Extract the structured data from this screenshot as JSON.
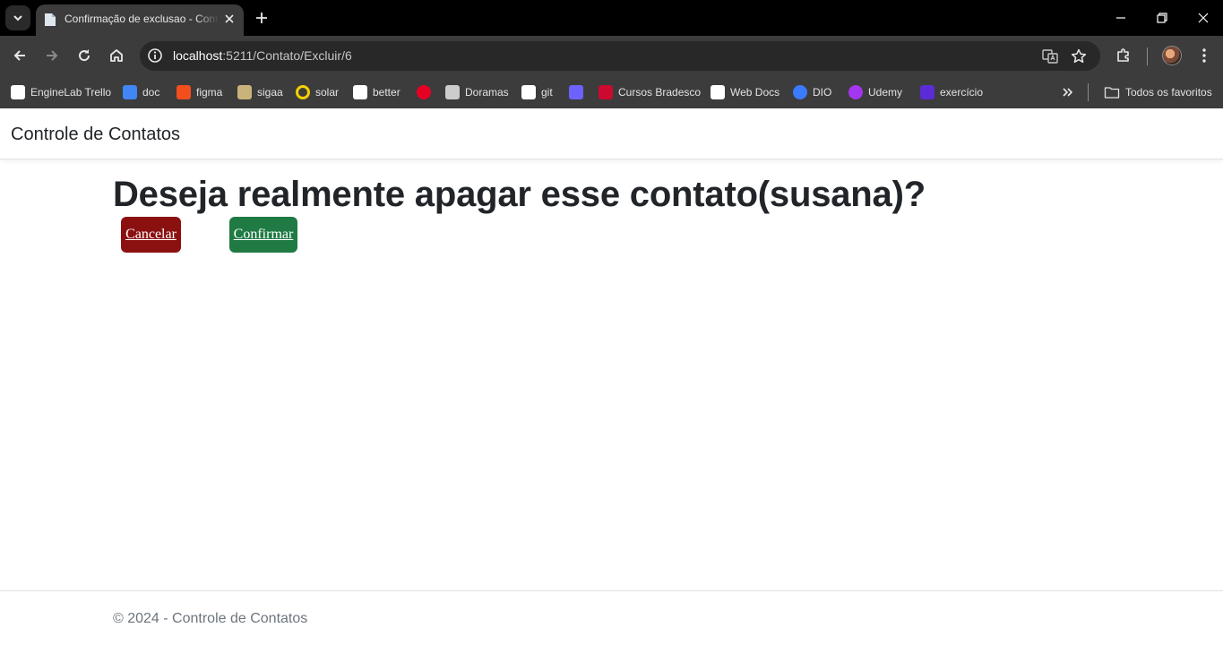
{
  "browser": {
    "tab": {
      "title": "Confirmação de exclusao - Controle de Contatos"
    },
    "address": {
      "host": "localhost",
      "path": ":5211/Contato/Excluir/6"
    },
    "bookmarks": [
      {
        "label": "EngineLab Trello",
        "icon": "trello-icon",
        "color": "#ffffff"
      },
      {
        "label": "doc",
        "icon": "docs-icon",
        "color": "#4285f4"
      },
      {
        "label": "figma",
        "icon": "figma-icon",
        "color": "#f24e1e"
      },
      {
        "label": "sigaa",
        "icon": "sigaa-icon",
        "color": "#c9b37a"
      },
      {
        "label": "solar",
        "icon": "solar-icon",
        "color": "#f5d000"
      },
      {
        "label": "better",
        "icon": "better-icon",
        "color": "#ffffff"
      },
      {
        "label": "",
        "icon": "pinterest-icon",
        "color": "#e60023"
      },
      {
        "label": "Doramas",
        "icon": "doramas-icon",
        "color": "#cccccc"
      },
      {
        "label": "git",
        "icon": "github-icon",
        "color": "#ffffff"
      },
      {
        "label": "",
        "icon": "s-app-icon",
        "color": "#6c63ff"
      },
      {
        "label": "Cursos Bradesco",
        "icon": "bradesco-icon",
        "color": "#cc092f"
      },
      {
        "label": "Web Docs",
        "icon": "mdn-icon",
        "color": "#ffffff"
      },
      {
        "label": "DIO",
        "icon": "dio-icon",
        "color": "#3a7bfd"
      },
      {
        "label": "Udemy",
        "icon": "udemy-icon",
        "color": "#a435f0"
      },
      {
        "label": "exercício",
        "icon": "exercicio-icon",
        "color": "#5b2bd6"
      }
    ],
    "all_bookmarks": "Todos os favoritos"
  },
  "app": {
    "brand": "Controle de Contatos",
    "heading": "Deseja realmente apagar esse contato(susana)?",
    "cancel_label": "Cancelar",
    "confirm_label": "Confirmar",
    "footer": "© 2024 - Controle de Contatos",
    "colors": {
      "cancel": "#8b1111",
      "confirm": "#1f7a44"
    }
  }
}
